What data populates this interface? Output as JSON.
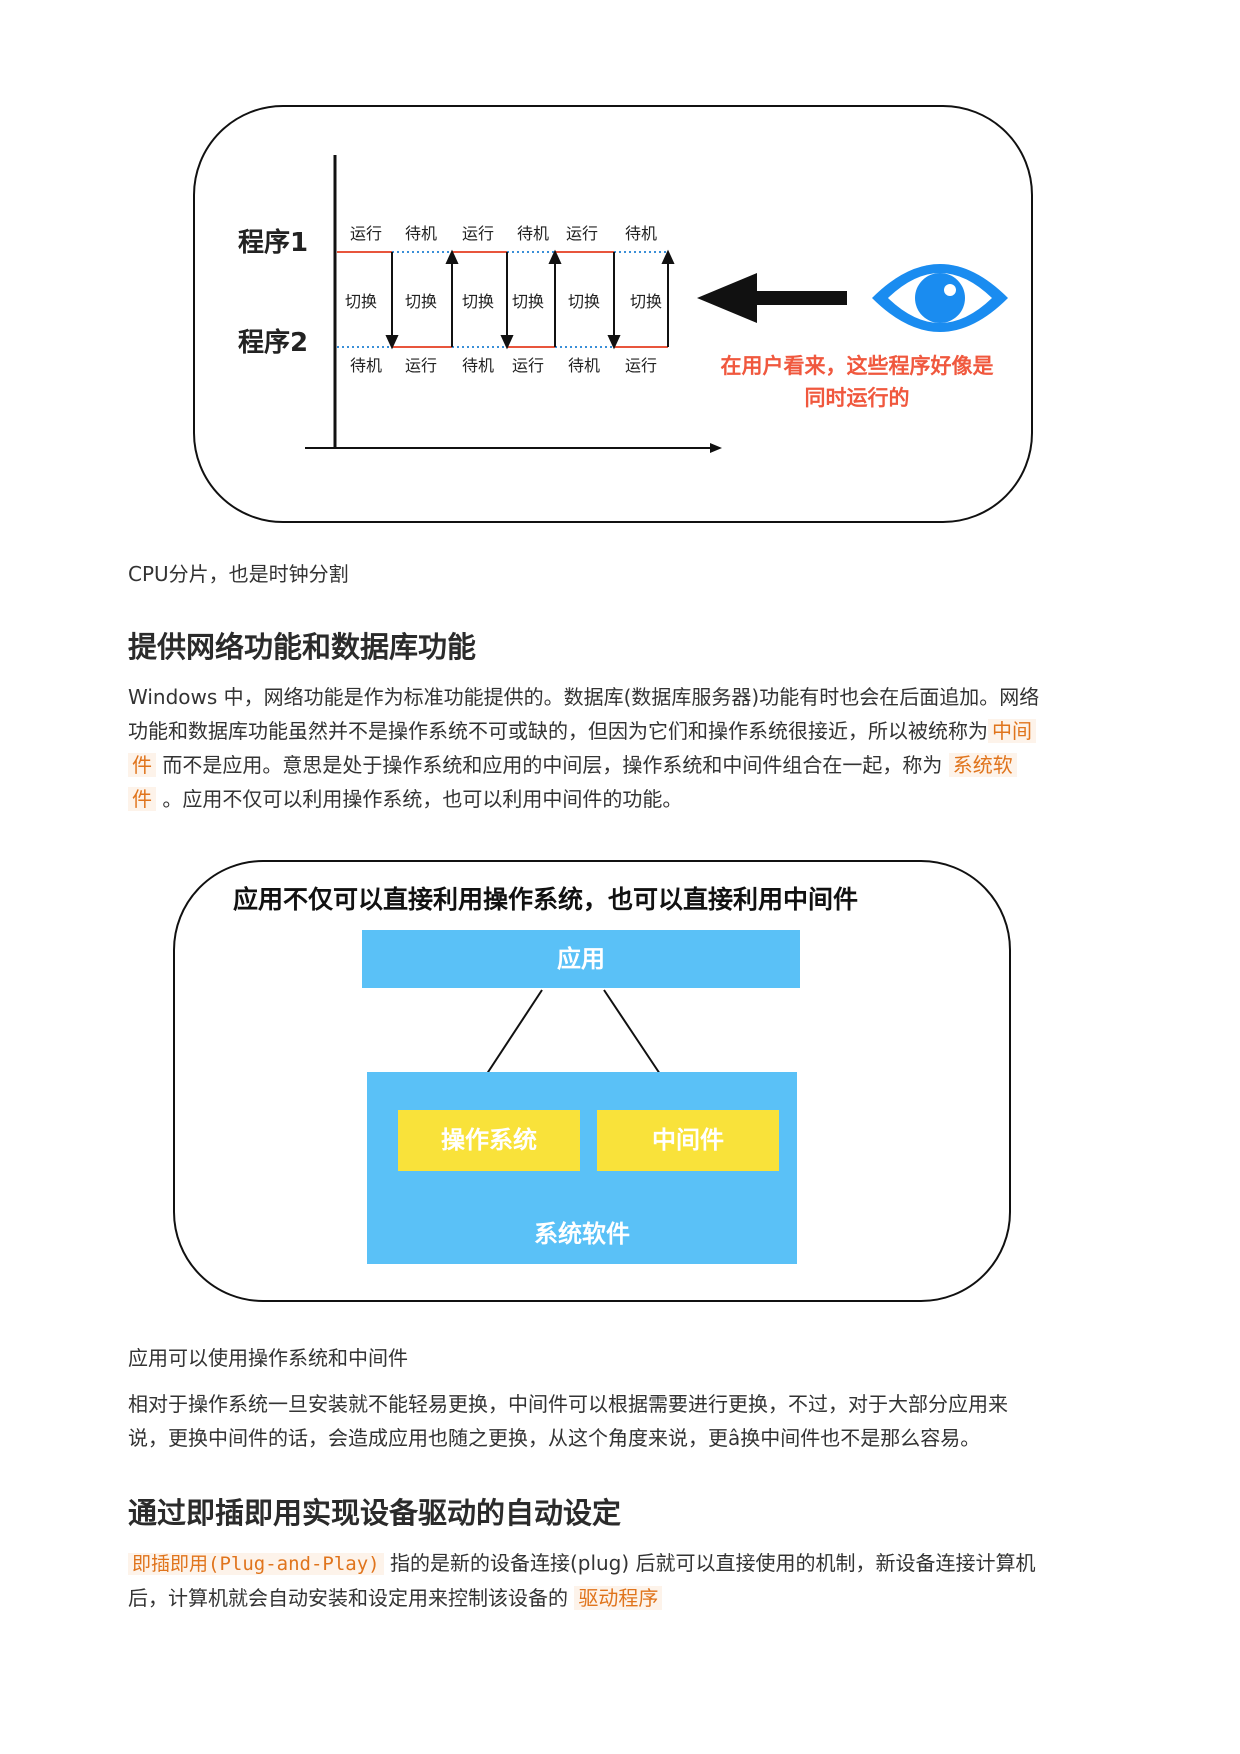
{
  "figure1": {
    "program1": "程序1",
    "program2": "程序2",
    "top_labels": [
      "运行",
      "待机",
      "运行",
      "待机",
      "运行",
      "待机"
    ],
    "switch_labels": [
      "切换",
      "切换",
      "切换",
      "切换",
      "切换",
      "切换"
    ],
    "bottom_labels": [
      "待机",
      "运行",
      "待机",
      "运行",
      "待机",
      "运行"
    ],
    "eye_caption_line1": "在用户看来，这些程序好像是",
    "eye_caption_line2": "同时运行的",
    "colors": {
      "run_line": "#e8553c",
      "wait_line": "#3a8fd8",
      "eye": "#1a8cf0",
      "caption": "#f0583e"
    }
  },
  "caption1": "CPU分片，也是时钟分割",
  "section1": {
    "heading": "提供网络功能和数据库功能",
    "para_line1": "Windows 中，网络功能是作为标准功能提供的。数据库(数据库服务器)功能有时也会在后面追加。网络",
    "para_line2a": "功能和数据库功能虽然并不是操作系统不可或缺的，但因为它们和操作系统很接近，所以被统称为",
    "para_line2_code": "中间",
    "para_line3_code": "件",
    "para_line3b": "而不是应用。意思是处于操作系统和应用的中间层，操作系统和中间件组合在一起，称为",
    "para_line3_code2": "系统软",
    "para_line4_code": "件",
    "para_line4b": "。应用不仅可以利用操作系统，也可以利用中间件的功能。"
  },
  "figure2": {
    "title": "应用不仅可以直接利用操作系统，也可以直接利用中间件",
    "app": "应用",
    "os": "操作系统",
    "middleware": "中间件",
    "system_software": "系统软件",
    "colors": {
      "blue": "#5ac1f7",
      "yellow": "#f9e23a"
    }
  },
  "caption2": "应用可以使用操作系统和中间件",
  "para2_line1": "相对于操作系统一旦安装就不能轻易更换，中间件可以根据需要进行更换，不过，对于大部分应用来",
  "para2_line2": "说，更换中间件的话，会造成应用也随之更换，从这个角度来说，更â换中间件也不是那么容易。",
  "section2": {
    "heading": "通过即插即用实现设备驱动的自动设定",
    "code1": "即插即用(Plug-and-Play)",
    "line1b": "指的是新的设备连接(plug) 后就可以直接使用的机制，新设备连接计算机",
    "line2a": "后，计算机就会自动安装和设定用来控制该设备的",
    "code2": "驱动程序"
  }
}
